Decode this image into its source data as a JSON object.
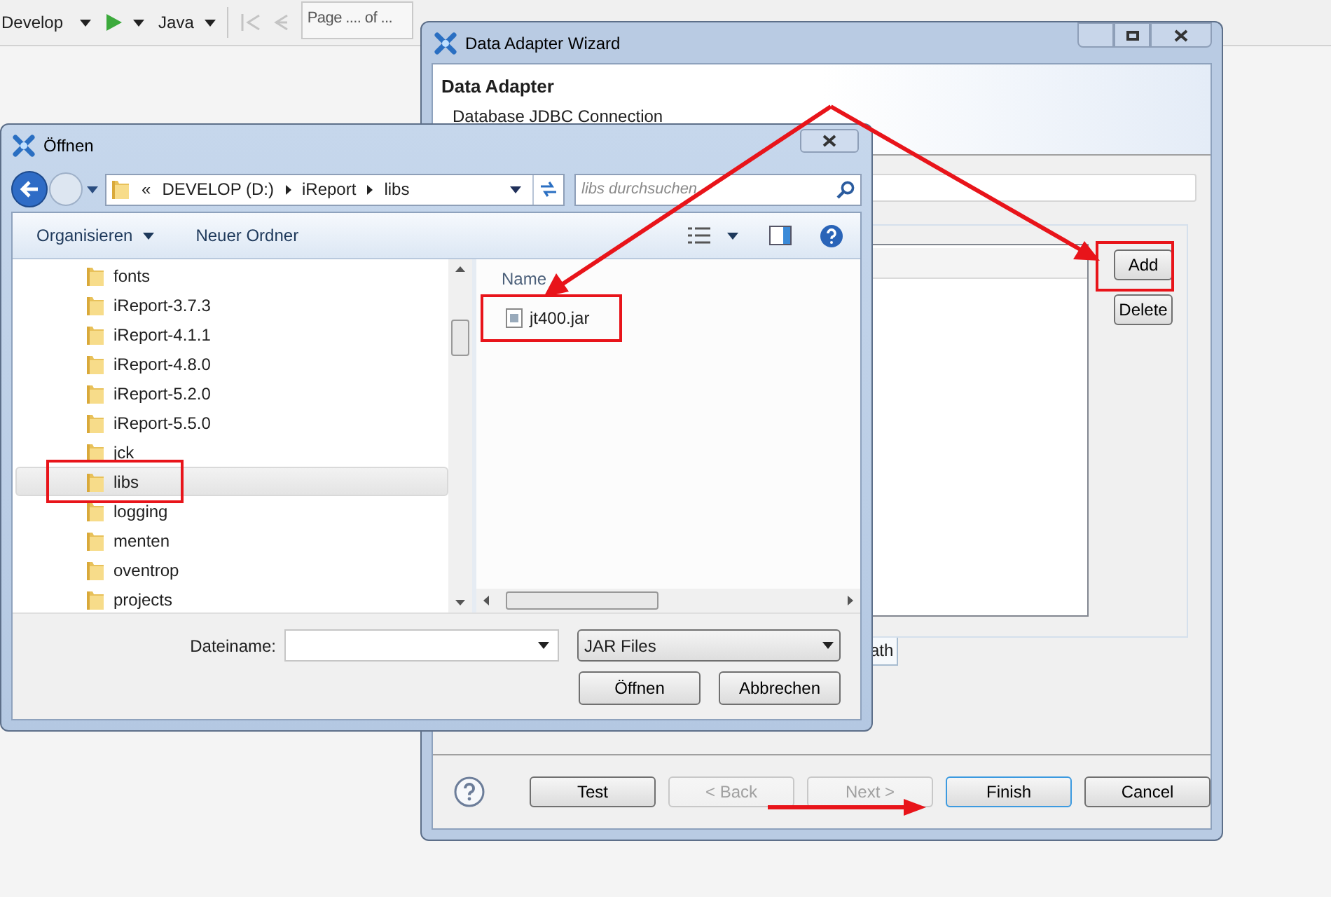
{
  "toolbar": {
    "profile": "Develop",
    "language": "Java",
    "page_field": {
      "value": "Page .... of ..."
    }
  },
  "wizard": {
    "title": "Data Adapter Wizard",
    "heading": "Data Adapter",
    "subtitle": "Database JDBC Connection",
    "side_buttons": [
      {
        "label": "Add"
      },
      {
        "label": "Delete"
      }
    ],
    "tabs": [
      {
        "label": "ath",
        "selected": true
      }
    ],
    "footer_buttons": [
      {
        "label": "Test",
        "disabled": false,
        "default": false
      },
      {
        "label": "< Back",
        "disabled": true,
        "default": false
      },
      {
        "label": "Next >",
        "disabled": true,
        "default": false
      },
      {
        "label": "Finish",
        "disabled": false,
        "default": true
      },
      {
        "label": "Cancel",
        "disabled": false,
        "default": false
      }
    ]
  },
  "open_dialog": {
    "title": "Öffnen",
    "overflow_mark": "«",
    "breadcrumb": [
      "DEVELOP (D:)",
      "iReport",
      "libs"
    ],
    "search": {
      "placeholder": "libs durchsuchen"
    },
    "commands": [
      {
        "label": "Organisieren",
        "dropdown": true
      },
      {
        "label": "Neuer Ordner",
        "dropdown": false
      }
    ],
    "folders": [
      {
        "name": "fonts",
        "selected": false
      },
      {
        "name": "iReport-3.7.3",
        "selected": false
      },
      {
        "name": "iReport-4.1.1",
        "selected": false
      },
      {
        "name": "iReport-4.8.0",
        "selected": false
      },
      {
        "name": "iReport-5.2.0",
        "selected": false
      },
      {
        "name": "iReport-5.5.0",
        "selected": false
      },
      {
        "name": "jck",
        "selected": false
      },
      {
        "name": "libs",
        "selected": true
      },
      {
        "name": "logging",
        "selected": false
      },
      {
        "name": "menten",
        "selected": false
      },
      {
        "name": "oventrop",
        "selected": false
      },
      {
        "name": "projects",
        "selected": false
      }
    ],
    "column_header": "Name",
    "files": [
      {
        "name": "jt400.jar"
      }
    ],
    "filename_label": "Dateiname:",
    "file_type": "JAR Files",
    "buttons": [
      {
        "label": "Öffnen"
      },
      {
        "label": "Abbrechen"
      }
    ]
  }
}
